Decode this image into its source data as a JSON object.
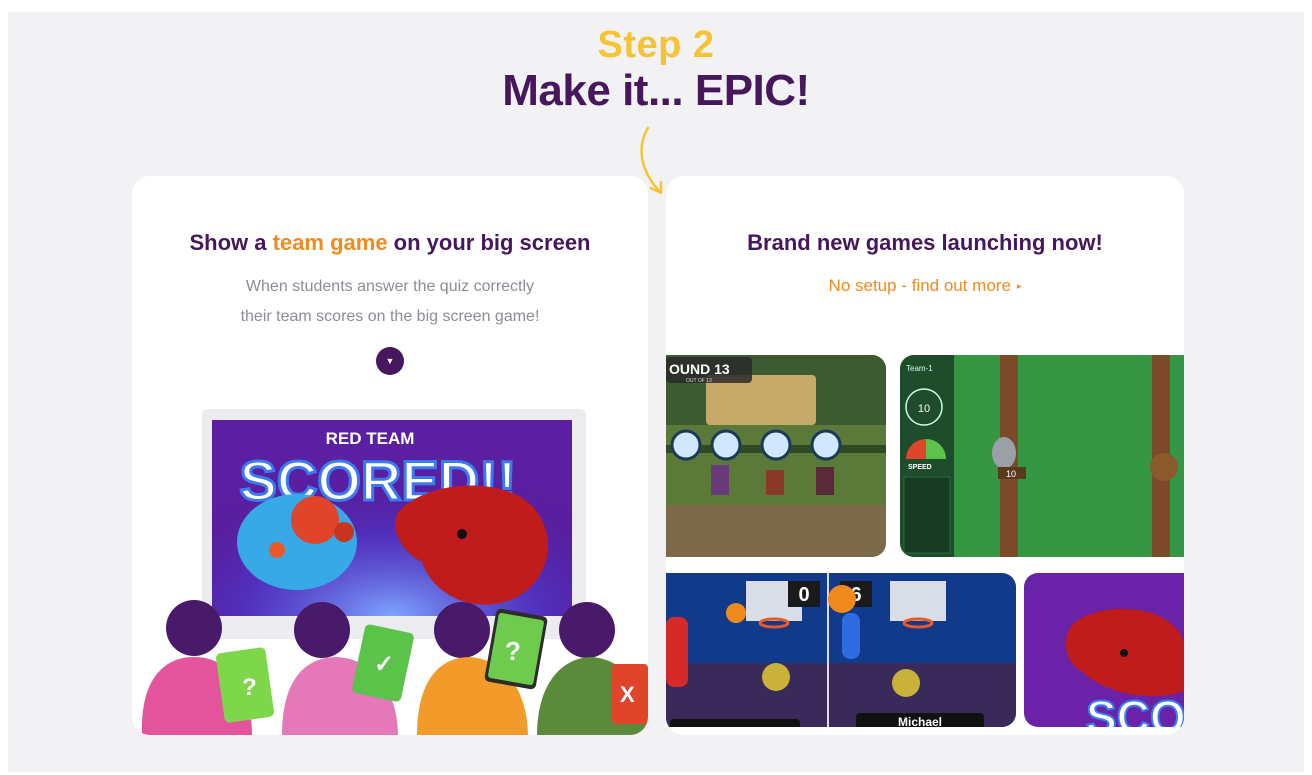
{
  "header": {
    "step": "Step 2",
    "headline": "Make it... EPIC!"
  },
  "left_card": {
    "title_before": "Show a ",
    "title_highlight": "team game",
    "title_after": " on your big screen",
    "description_line1": "When students answer the quiz correctly",
    "description_line2": "their team scores on the big screen game!",
    "expand_icon": "chevron-down-icon",
    "illustration": {
      "team_label": "RED TEAM",
      "scored_text": "SCORED!!"
    }
  },
  "right_card": {
    "title": "Brand new games launching now!",
    "link_text": "No setup - find out more",
    "link_icon": "chevron-right-icon",
    "thumbnails": {
      "tower": {
        "round_label": "OUND 13",
        "round_sub": "OUT OF 13"
      },
      "climb": {
        "team_label": "Team-1",
        "timer": "10",
        "speed_label": "SPEED",
        "player_score": "10"
      },
      "basketball": {
        "score_left": "0",
        "score_right": "6",
        "player_name": "Michael"
      },
      "monster": {
        "text": "SCO"
      }
    }
  },
  "colors": {
    "primary_purple": "#46175c",
    "accent_orange": "#f28b1c",
    "step_yellow": "#f5c334",
    "page_bg": "#f2f2f5"
  }
}
